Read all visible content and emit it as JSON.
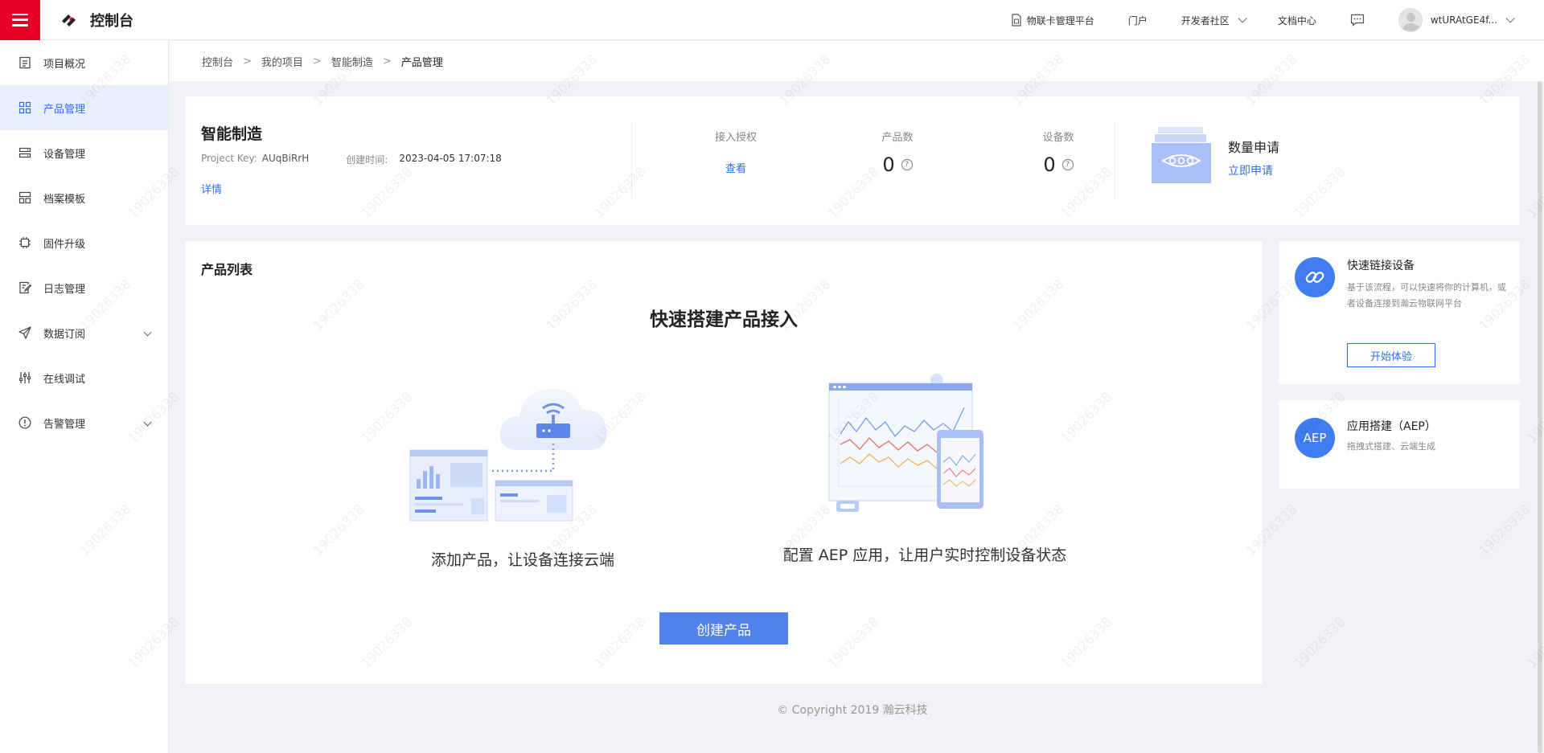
{
  "topbar": {
    "title": "控制台",
    "links": [
      {
        "label": "物联卡管理平台"
      },
      {
        "label": "门户"
      },
      {
        "label": "开发者社区"
      },
      {
        "label": "文档中心"
      }
    ],
    "username": "wtURAtGE4f...",
    "accent_color": "#e60026"
  },
  "sidebar": {
    "items": [
      {
        "label": "项目概况",
        "icon": "file-text-icon"
      },
      {
        "label": "产品管理",
        "icon": "grid-icon"
      },
      {
        "label": "设备管理",
        "icon": "server-icon"
      },
      {
        "label": "档案模板",
        "icon": "layout-icon"
      },
      {
        "label": "固件升级",
        "icon": "chip-icon"
      },
      {
        "label": "日志管理",
        "icon": "edit-log-icon"
      },
      {
        "label": "数据订阅",
        "icon": "send-icon"
      },
      {
        "label": "在线调试",
        "icon": "sliders-icon"
      },
      {
        "label": "告警管理",
        "icon": "alert-icon"
      }
    ],
    "active_index": 1
  },
  "breadcrumb": [
    "控制台",
    "我的项目",
    "智能制造",
    "产品管理"
  ],
  "project": {
    "name": "智能制造",
    "key_label": "Project Key:",
    "key_value": "AUqBiRrH",
    "created_label": "创建时间:",
    "created_value": "2023-04-05 17:07:18",
    "detail_link": "详情",
    "stats": {
      "auth_label": "接入授权",
      "auth_link": "查看",
      "product_label": "产品数",
      "product_count": "0",
      "device_label": "设备数",
      "device_count": "0"
    },
    "quota_title": "数量申请",
    "quota_link": "立即申请"
  },
  "product_list": {
    "title": "产品列表",
    "hero_title": "快速搭建产品接入",
    "caption_left": "添加产品，让设备连接云端",
    "caption_right": "配置 AEP 应用，让用户实时控制设备状态",
    "create_button": "创建产品"
  },
  "side_cards": [
    {
      "title": "快速链接设备",
      "desc": "基于该流程，可以快速将你的计算机，或者设备连接到瀚云物联网平台",
      "button": "开始体验"
    },
    {
      "icon_text": "AEP",
      "title": "应用搭建（AEP）",
      "desc": "拖拽式搭建、云端生成"
    }
  ],
  "footer": "© Copyright 2019 瀚云科技",
  "watermark": "19026338",
  "colors": {
    "primary": "#2f6df6",
    "button": "#5181ea",
    "active_bg": "#e8f0fd"
  }
}
